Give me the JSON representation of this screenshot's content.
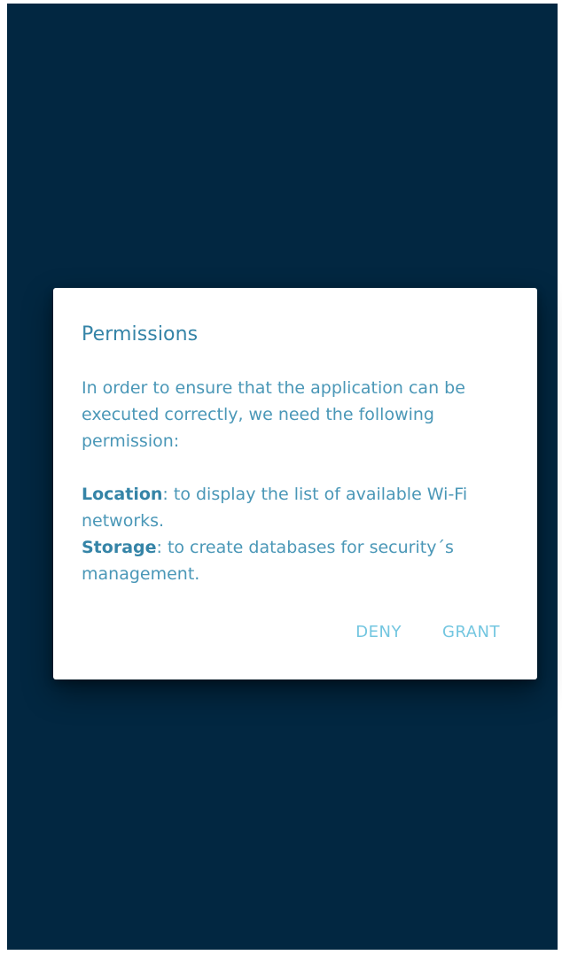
{
  "dialog": {
    "title": "Permissions",
    "intro": "In order to ensure that the application can be executed correctly, we need the following permission:",
    "permissions": [
      {
        "name": "Location",
        "description": ": to display the list of available Wi-Fi networks."
      },
      {
        "name": "Storage",
        "description": ": to create databases for security´s management."
      }
    ],
    "deny_label": "DENY",
    "grant_label": "GRANT"
  },
  "colors": {
    "background": "#022741",
    "dialog_bg": "#ffffff",
    "text": "#4a97b7",
    "button_text": "#73c6e0"
  }
}
